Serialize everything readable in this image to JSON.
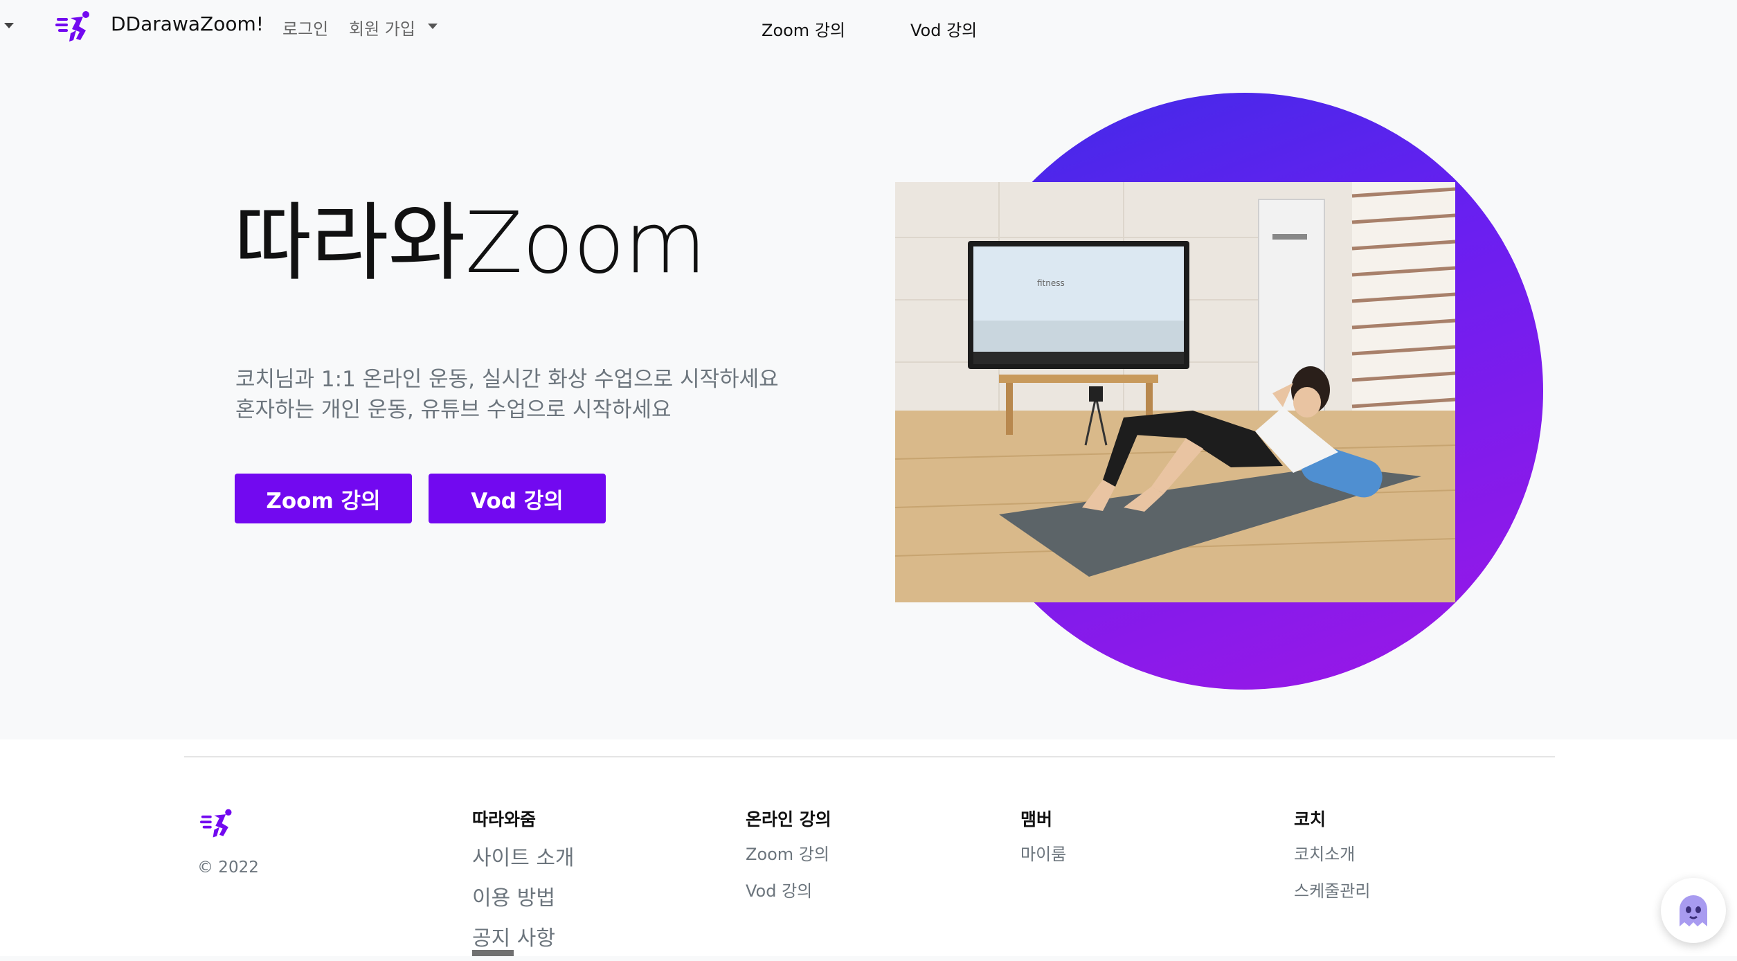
{
  "navbar": {
    "brand": "DDarawaZoom!",
    "login": "로그인",
    "signup": "회원 가입",
    "zoom": "Zoom 강의",
    "vod": "Vod 강의"
  },
  "hero": {
    "title": "따라와Zoom",
    "line1": "코치님과 1:1 온라인 운동, 실시간 화상 수업으로 시작하세요",
    "line2": "혼자하는 개인 운동, 유튜브 수업으로 시작하세요",
    "btn_zoom": "Zoom 강의",
    "btn_vod": "Vod 강의",
    "photo_tv_text": "fitness"
  },
  "footer": {
    "copyright": "© 2022",
    "col1": {
      "title": "따라와줌",
      "links": [
        "사이트 소개",
        "이용 방법",
        "공지 사항"
      ]
    },
    "col2": {
      "title": "온라인 강의",
      "links": [
        "Zoom 강의",
        "Vod 강의"
      ]
    },
    "col3": {
      "title": "맴버",
      "links": [
        "마이룸"
      ]
    },
    "col4": {
      "title": "코치",
      "links": [
        "코치소개",
        "스케줄관리"
      ]
    }
  },
  "colors": {
    "accent": "#7209f0",
    "circle_start": "#3f2be8",
    "circle_end": "#9d17e6"
  },
  "icons": {
    "brand": "running-man-icon",
    "chat": "chatbot-ghost-icon"
  }
}
